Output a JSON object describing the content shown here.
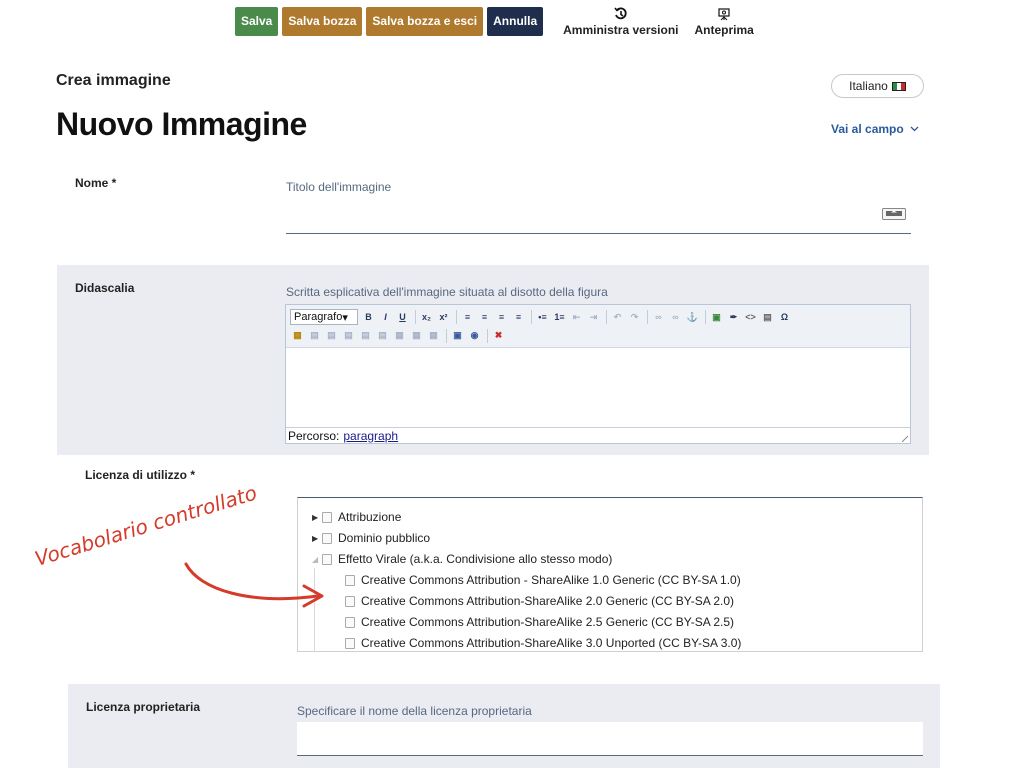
{
  "toolbar": {
    "save": "Salva",
    "save_draft": "Salva bozza",
    "save_draft_exit": "Salva bozza e esci",
    "cancel": "Annulla",
    "manage_versions": "Amministra versioni",
    "preview": "Anteprima"
  },
  "page": {
    "subtitle": "Crea immagine",
    "title": "Nuovo Immagine",
    "language": "Italiano",
    "goto_field": "Vai al campo"
  },
  "fields": {
    "nome": {
      "label": "Nome *",
      "hint": "Titolo dell'immagine",
      "value": ""
    },
    "didascalia": {
      "label": "Didascalia",
      "hint": "Scritta esplicativa dell'immagine situata al disotto della figura",
      "format_select": "Paragrafo",
      "path_label": "Percorso:",
      "path_value": "paragraph"
    },
    "licenza": {
      "label": "Licenza di utilizzo *",
      "tree": [
        {
          "label": "Attribuzione",
          "expanded": false
        },
        {
          "label": "Dominio pubblico",
          "expanded": false
        },
        {
          "label": "Effetto Virale (a.k.a. Condivisione allo stesso modo)",
          "expanded": true,
          "children": [
            "Creative Commons Attribution - ShareAlike 1.0 Generic (CC BY-SA 1.0)",
            "Creative Commons Attribution-ShareAlike 2.0 Generic (CC BY-SA 2.0)",
            "Creative Commons Attribution-ShareAlike 2.5 Generic (CC BY-SA 2.5)",
            "Creative Commons Attribution-ShareAlike 3.0 Unported (CC BY-SA 3.0)"
          ]
        }
      ]
    },
    "licenza_proprietaria": {
      "label": "Licenza proprietaria",
      "hint": "Specificare il nome della licenza proprietaria",
      "value": ""
    }
  },
  "annotation": {
    "text": "Vocabolario controllato",
    "color": "#d63a2a"
  },
  "colors": {
    "save": "#4a8a4a",
    "draft": "#b07a2e",
    "cancel": "#1f2e4d",
    "link": "#2a5a9c",
    "panel": "#ebebf2"
  }
}
